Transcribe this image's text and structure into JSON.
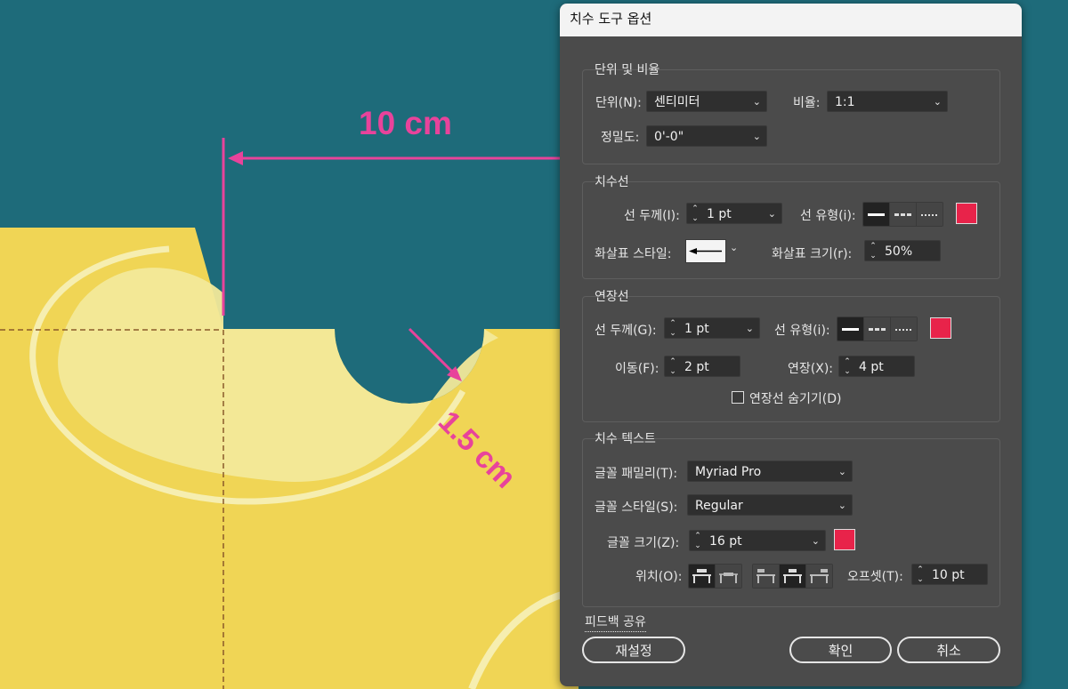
{
  "canvas": {
    "horizontal_dimension": "10 cm",
    "radius_dimension": "1.5 cm",
    "colors": {
      "background": "#1e6b7a",
      "yellow": "#f0d555",
      "light_yellow": "#f2e99a",
      "accent": "#e8439b"
    }
  },
  "dialog": {
    "title": "치수 도구 옵션",
    "units_section": {
      "title": "단위 및 비율",
      "unit_label": "단위(N):",
      "unit_value": "센티미터",
      "ratio_label": "비율:",
      "ratio_value": "1:1",
      "precision_label": "정밀도:",
      "precision_value": "0'-0\""
    },
    "dimension_line": {
      "title": "치수선",
      "weight_label": "선 두께(I):",
      "weight_value": "1 pt",
      "type_label": "선 유형(i):",
      "arrow_style_label": "화살표 스타일:",
      "arrow_size_label": "화살표 크기(r):",
      "arrow_size_value": "50%",
      "color": "#e8234a"
    },
    "extension_line": {
      "title": "연장선",
      "weight_label": "선 두께(G):",
      "weight_value": "1 pt",
      "type_label": "선 유형(i):",
      "move_label": "이동(F):",
      "move_value": "2 pt",
      "extend_label": "연장(X):",
      "extend_value": "4 pt",
      "hide_label": "연장선 숨기기(D)",
      "color": "#e8234a"
    },
    "dimension_text": {
      "title": "치수 텍스트",
      "font_family_label": "글꼴 패밀리(T):",
      "font_family_value": "Myriad Pro",
      "font_style_label": "글꼴 스타일(S):",
      "font_style_value": "Regular",
      "font_size_label": "글꼴 크기(Z):",
      "font_size_value": "16 pt",
      "position_label": "위치(O):",
      "offset_label": "오프셋(T):",
      "offset_value": "10 pt",
      "color": "#e8234a"
    },
    "feedback_link": "피드백 공유",
    "reset_button": "재설정",
    "ok_button": "확인",
    "cancel_button": "취소"
  }
}
